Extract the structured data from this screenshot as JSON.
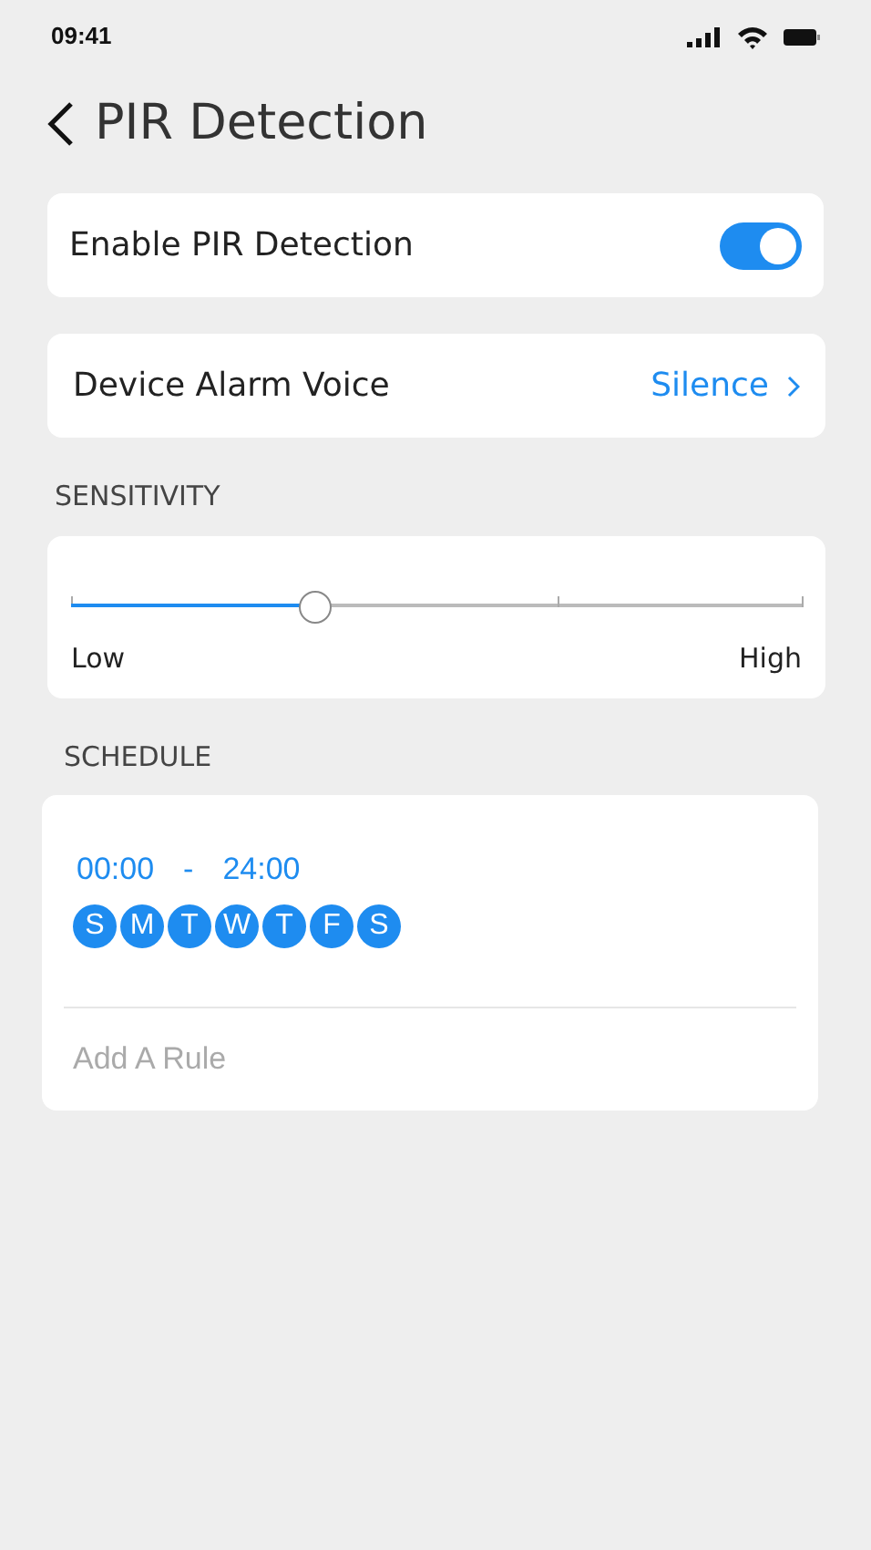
{
  "status_bar": {
    "time": "09:41"
  },
  "header": {
    "title": "PIR Detection"
  },
  "enable": {
    "label": "Enable PIR Detection",
    "on": true
  },
  "alarm_voice": {
    "label": "Device Alarm Voice",
    "value": "Silence"
  },
  "sensitivity": {
    "heading": "SENSITIVITY",
    "level": 0.333,
    "min_label": "Low",
    "max_label": "High"
  },
  "schedule": {
    "heading": "SCHEDULE",
    "start": "00:00",
    "separator": "-",
    "end": "24:00",
    "days": [
      {
        "label": "S",
        "selected": true
      },
      {
        "label": "M",
        "selected": true
      },
      {
        "label": "T",
        "selected": true
      },
      {
        "label": "W",
        "selected": true
      },
      {
        "label": "T",
        "selected": true
      },
      {
        "label": "F",
        "selected": true
      },
      {
        "label": "S",
        "selected": true
      }
    ],
    "add_rule": "Add A Rule"
  }
}
